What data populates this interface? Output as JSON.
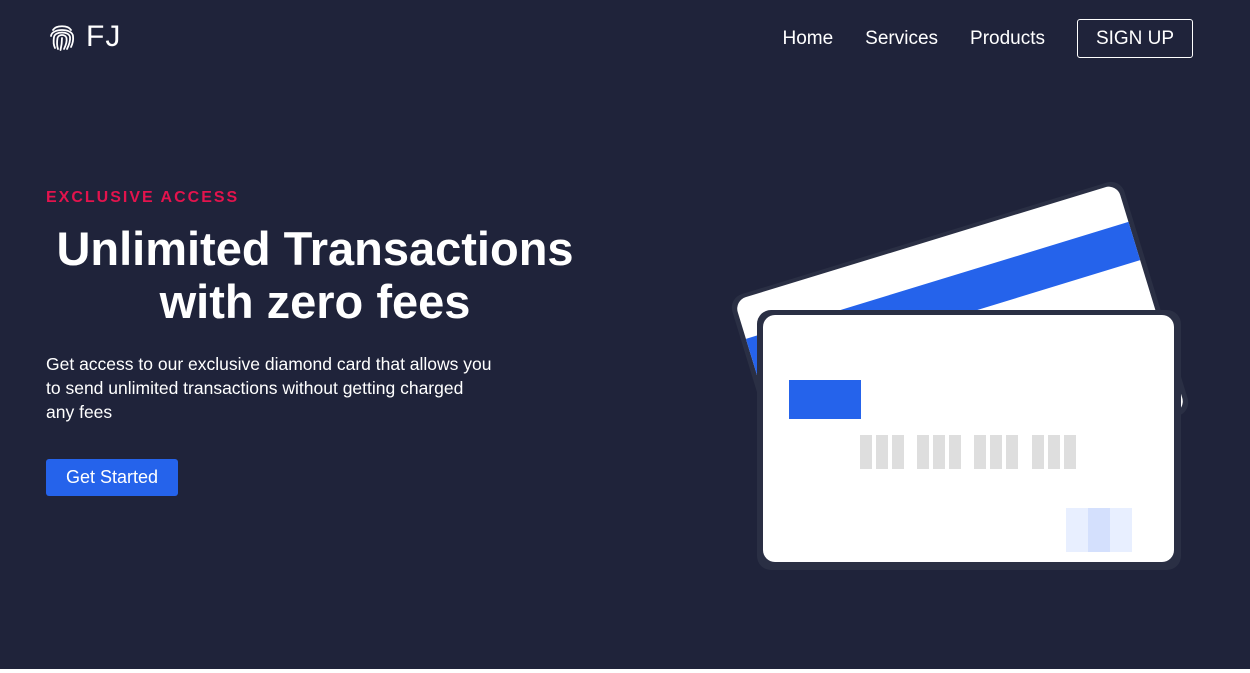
{
  "brand": {
    "name": "FJ",
    "icon": "fingerprint-icon"
  },
  "nav": {
    "links": [
      "Home",
      "Services",
      "Products"
    ],
    "signup_label": "SIGN UP"
  },
  "hero": {
    "eyebrow": "EXCLUSIVE ACCESS",
    "headline_line1": "Unlimited Transactions",
    "headline_line2": "with zero fees",
    "description": "Get access to our exclusive diamond card that allows you to send unlimited transactions without getting charged any fees",
    "cta_label": "Get Started"
  },
  "colors": {
    "background": "#1f233a",
    "accent": "#e3134d",
    "primary": "#2563eb",
    "card": "#ffffff",
    "card_stripe": "#2563eb",
    "card_digits": "#dedede"
  }
}
